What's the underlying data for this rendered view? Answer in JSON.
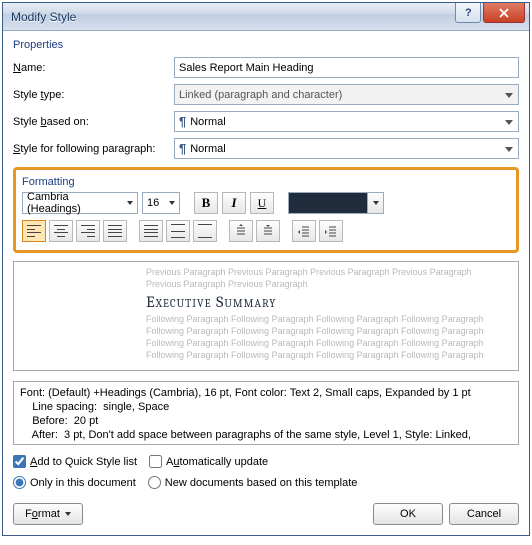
{
  "title": "Modify Style",
  "sections": {
    "properties_label": "Properties",
    "formatting_label": "Formatting"
  },
  "properties": {
    "name_label": "Name:",
    "name_value": "Sales Report Main Heading",
    "type_label": "Style type:",
    "type_value": "Linked (paragraph and character)",
    "based_label": "Style based on:",
    "based_value": "Normal",
    "following_label": "Style for following paragraph:",
    "following_value": "Normal"
  },
  "formatting": {
    "font": "Cambria (Headings)",
    "size": "16",
    "bold_glyph": "B",
    "italic_glyph": "I",
    "underline_glyph": "U",
    "color": "#1f2d3d"
  },
  "preview": {
    "prev_paragraph": "Previous Paragraph Previous Paragraph Previous Paragraph Previous Paragraph Previous Paragraph Previous Paragraph",
    "heading": "Executive Summary",
    "following_paragraph": "Following Paragraph Following Paragraph Following Paragraph Following Paragraph Following Paragraph Following Paragraph Following Paragraph Following Paragraph Following Paragraph Following Paragraph Following Paragraph Following Paragraph Following Paragraph Following Paragraph Following Paragraph Following Paragraph"
  },
  "description": {
    "line1": "Font: (Default) +Headings (Cambria), 16 pt, Font color: Text 2, Small caps, Expanded by  1 pt",
    "line2": "    Line spacing:  single, Space",
    "line3": "    Before:  20 pt",
    "line4": "    After:  3 pt, Don't add space between paragraphs of the same style, Level 1, Style: Linked,"
  },
  "options": {
    "add_quick": "Add to Quick Style list",
    "auto_update": "Automatically update",
    "only_doc": "Only in this document",
    "new_docs": "New documents based on this template"
  },
  "buttons": {
    "format": "Format",
    "ok": "OK",
    "cancel": "Cancel"
  }
}
